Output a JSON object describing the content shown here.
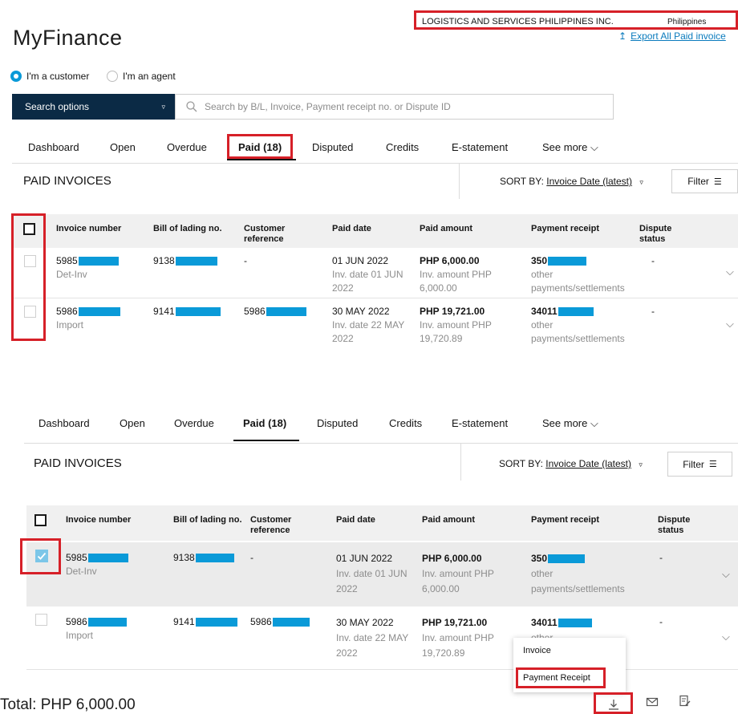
{
  "app": {
    "title": "MyFinance"
  },
  "company": {
    "name": "LOGISTICS AND SERVICES PHILIPPINES INC.",
    "country": "Philippines"
  },
  "export": {
    "label": "Export All Paid invoice"
  },
  "role": {
    "customer": "I'm a customer",
    "agent": "I'm an agent",
    "selected": "customer"
  },
  "search": {
    "options_label": "Search options",
    "placeholder": "Search by B/L, Invoice, Payment receipt no. or Dispute ID"
  },
  "tabs": [
    "Dashboard",
    "Open",
    "Overdue",
    "Paid (18)",
    "Disputed",
    "Credits",
    "E-statement",
    "See more"
  ],
  "active_tab": "Paid (18)",
  "section": {
    "title": "PAID INVOICES",
    "sort_label": "SORT BY:",
    "sort_value": "Invoice Date (latest)",
    "filter": "Filter"
  },
  "table": {
    "headers": [
      "Invoice number",
      "Bill of lading no.",
      "Customer reference",
      "Paid date",
      "Paid amount",
      "Payment receipt",
      "Dispute status"
    ],
    "rows": [
      {
        "invoice": "5985",
        "invoice_type": "Det-Inv",
        "bl": "9138",
        "customer_ref": "-",
        "paid_date": "01 JUN 2022",
        "inv_date": "Inv. date 01 JUN 2022",
        "paid_amount": "PHP 6,000.00",
        "inv_amount": "Inv. amount PHP 6,000.00",
        "receipt": "350",
        "receipt_note": "other payments/settlements",
        "dispute": "-"
      },
      {
        "invoice": "5986",
        "invoice_type": "Import",
        "bl": "9141",
        "customer_ref": "5986",
        "paid_date": "30 MAY 2022",
        "inv_date": "Inv. date 22 MAY 2022",
        "paid_amount": "PHP 19,721.00",
        "inv_amount": "Inv. amount PHP 19,720.89",
        "receipt": "34011",
        "receipt_note": "other payments/settlements",
        "dispute": "-"
      }
    ]
  },
  "download_menu": {
    "items": [
      "Invoice",
      "Payment Receipt"
    ]
  },
  "total": {
    "label": "Total: PHP 6,000.00"
  },
  "colors": {
    "accent": "#0a9ad8",
    "navy": "#0b2a45",
    "highlight": "#d62028",
    "selected_row": "#ebebeb"
  }
}
